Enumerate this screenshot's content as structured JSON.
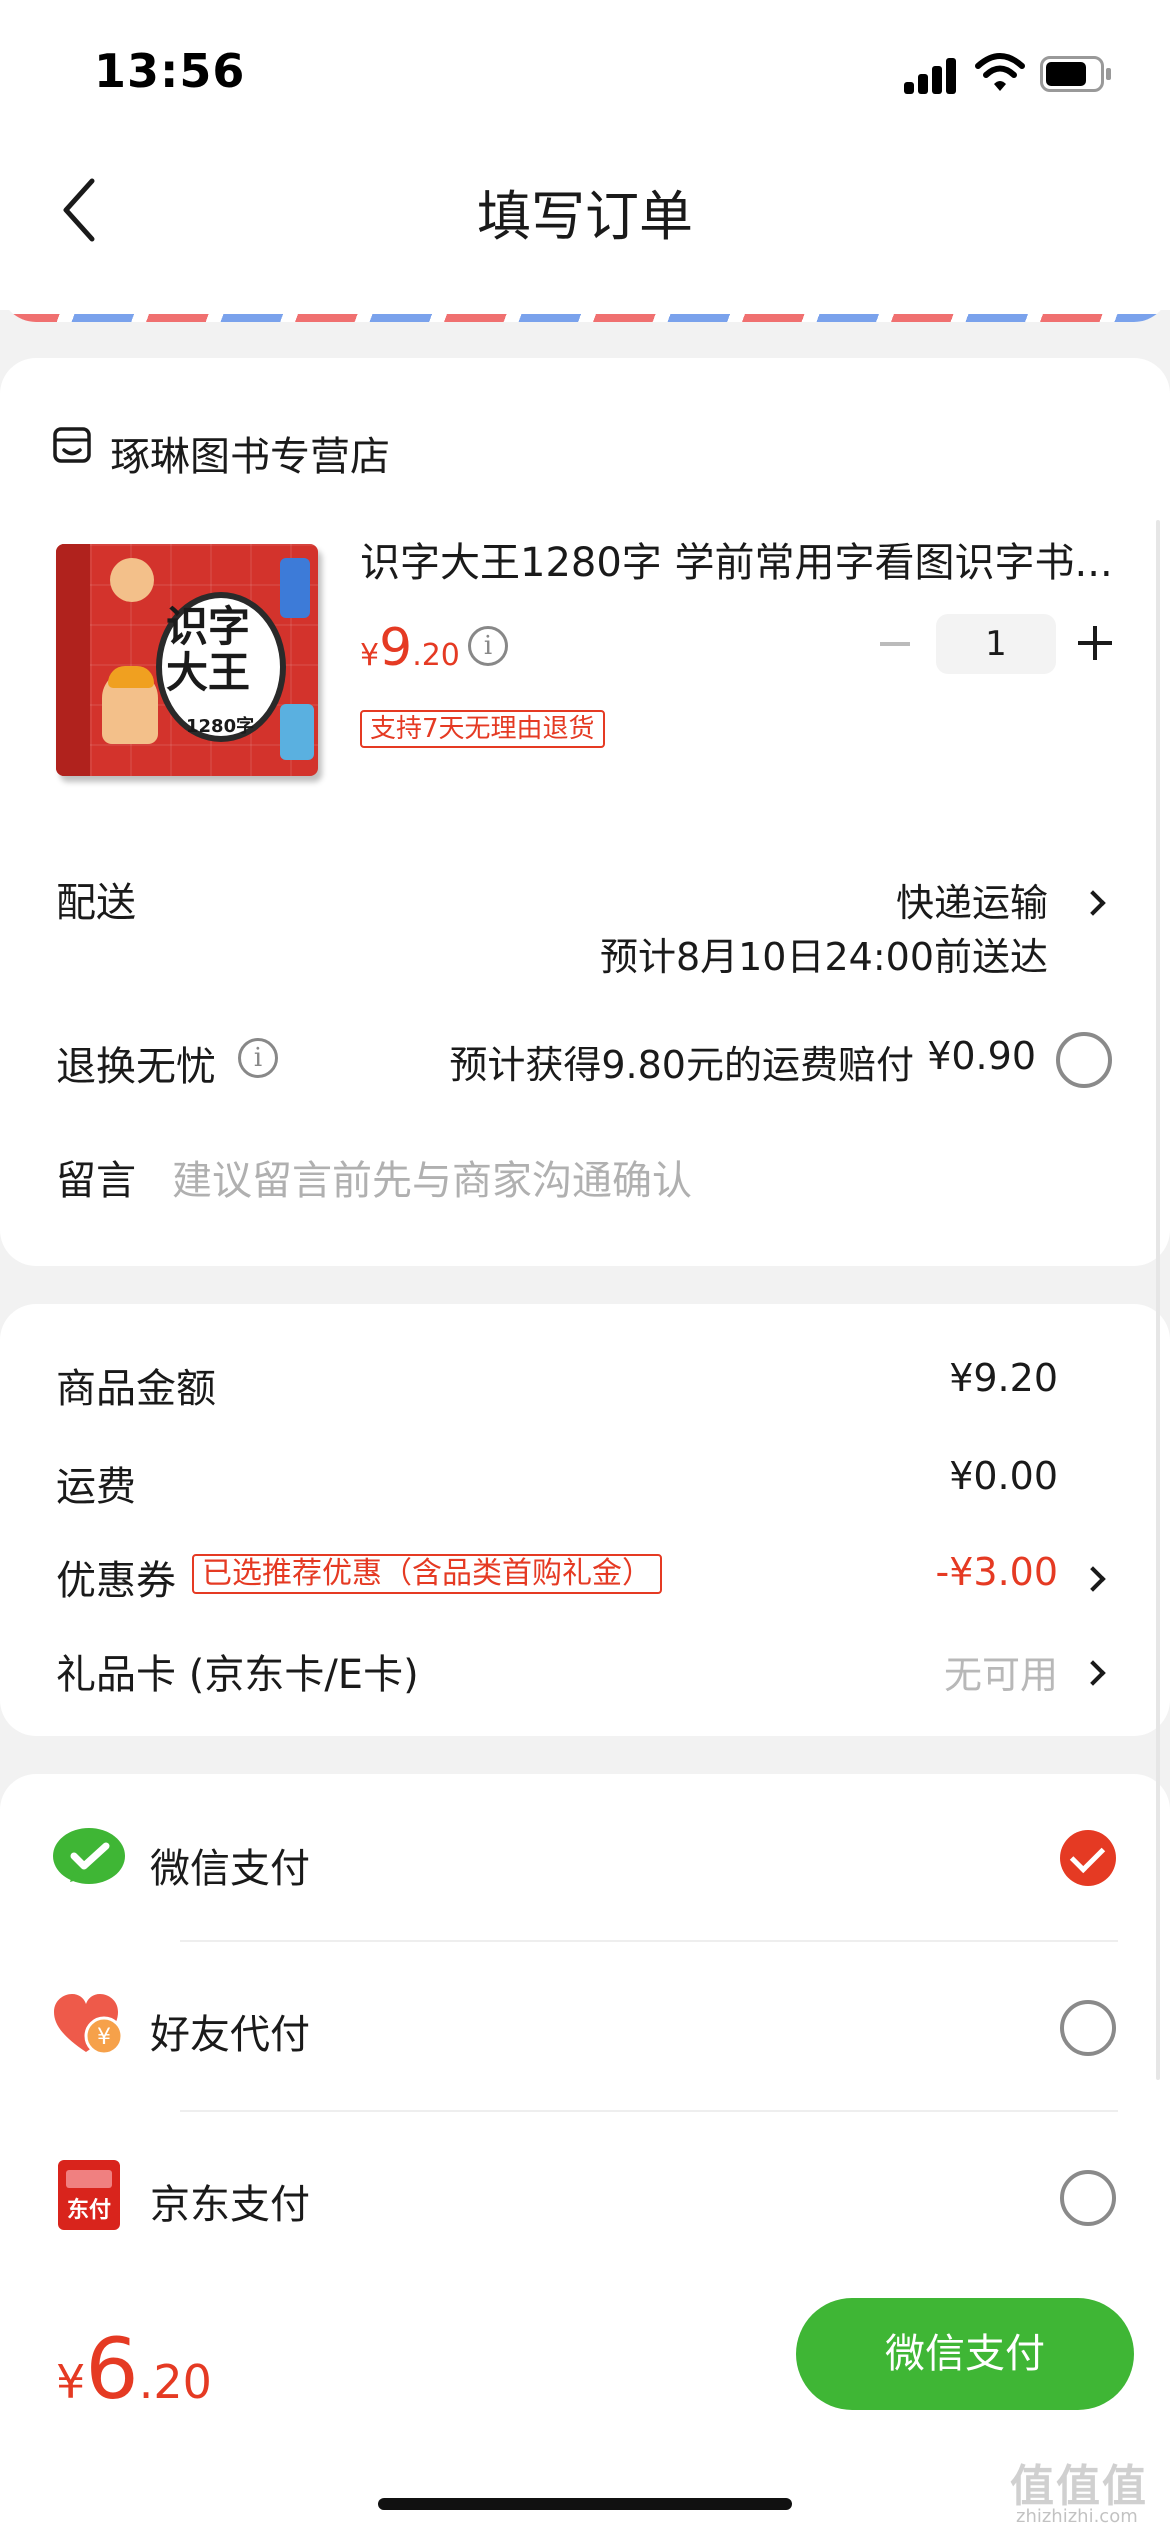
{
  "status_bar": {
    "time": "13:56"
  },
  "nav": {
    "title": "填写订单"
  },
  "store": {
    "name": "琢琳图书专营店",
    "product": {
      "title": "识字大王1280字 学前常用字看图识字书...",
      "cover_title": "识字大王",
      "cover_sub": "1280字",
      "price_currency": "¥",
      "price_int": "9",
      "price_dec": ".20",
      "quantity": "1",
      "return_tag": "支持7天无理由退货"
    }
  },
  "delivery": {
    "label": "配送",
    "method": "快递运输",
    "eta": "预计8月10日24:00前送达"
  },
  "return_insurance": {
    "label": "退换无忧",
    "desc": "预计获得9.80元的运费赔付",
    "price": "¥0.90"
  },
  "message": {
    "label": "留言",
    "placeholder": "建议留言前先与商家沟通确认"
  },
  "summary": {
    "goods_label": "商品金额",
    "goods_value": "¥9.20",
    "shipping_label": "运费",
    "shipping_value": "¥0.00",
    "coupon_label": "优惠券",
    "coupon_tag": "已选推荐优惠（含品类首购礼金）",
    "coupon_value": "-¥3.00",
    "giftcard_label": "礼品卡 (京东卡/E卡)",
    "giftcard_value": "无可用"
  },
  "payment": {
    "options": [
      {
        "label": "微信支付",
        "selected": true,
        "icon": "wechat-pay-icon"
      },
      {
        "label": "好友代付",
        "selected": false,
        "icon": "friend-pay-icon"
      },
      {
        "label": "京东支付",
        "selected": false,
        "icon": "jd-pay-icon"
      }
    ],
    "jd_icon_text": "东付"
  },
  "footer": {
    "total_currency": "¥",
    "total_int": "6",
    "total_dec": ".20",
    "pay_button": "微信支付",
    "watermark": "值值值",
    "watermark_sub": "zhizhizhi.com"
  },
  "colors": {
    "accent_red": "#e53a23",
    "wechat_green": "#3fb635"
  }
}
